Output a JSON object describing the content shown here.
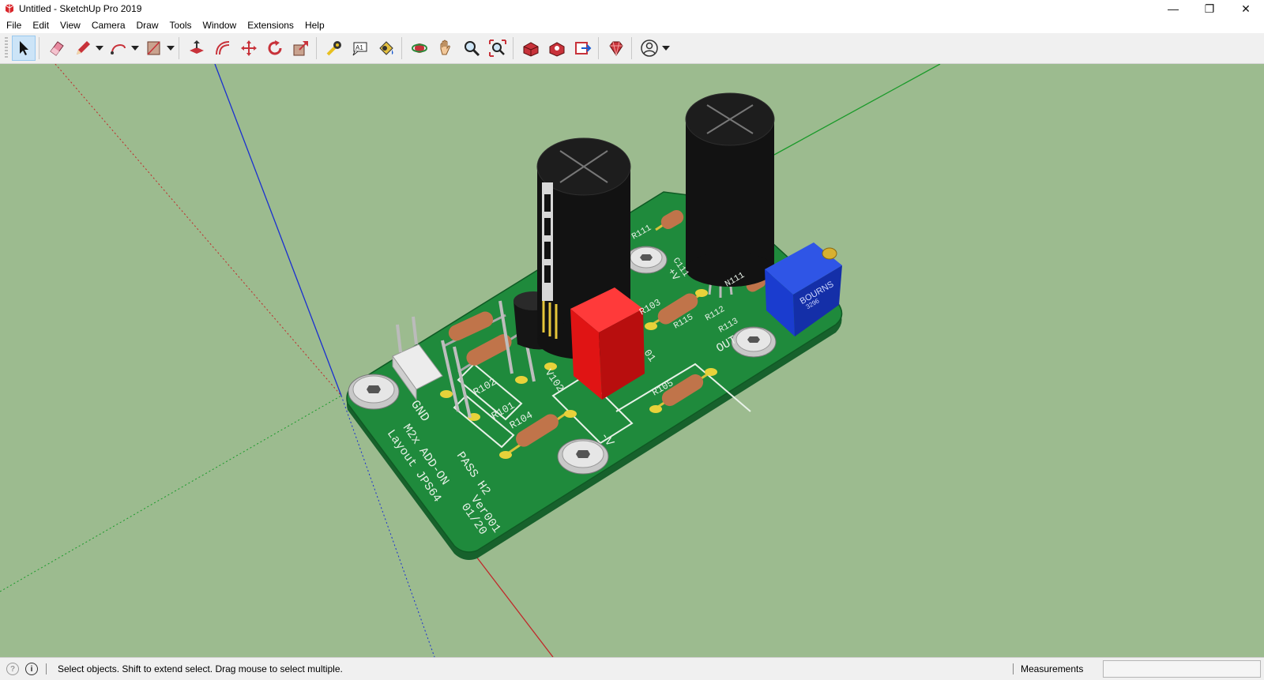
{
  "window": {
    "title": "Untitled - SketchUp Pro 2019",
    "controls": {
      "minimize": "—",
      "restore": "❐",
      "close": "✕"
    }
  },
  "menu": [
    "File",
    "Edit",
    "View",
    "Camera",
    "Draw",
    "Tools",
    "Window",
    "Extensions",
    "Help"
  ],
  "toolbar": [
    {
      "name": "select-tool",
      "icon": "arrow-cursor-icon",
      "active": true
    },
    {
      "name": "eraser-tool",
      "icon": "eraser-icon"
    },
    {
      "name": "line-tool",
      "icon": "pencil-icon",
      "dropdown": true
    },
    {
      "name": "arc-tool",
      "icon": "arc-icon",
      "dropdown": true
    },
    {
      "name": "shape-tool",
      "icon": "rectangle-icon",
      "dropdown": true
    },
    {
      "name": "push-pull-tool",
      "icon": "push-pull-icon"
    },
    {
      "name": "offset-tool",
      "icon": "offset-icon"
    },
    {
      "name": "move-tool",
      "icon": "move-icon"
    },
    {
      "name": "rotate-tool",
      "icon": "rotate-icon"
    },
    {
      "name": "scale-tool",
      "icon": "scale-icon"
    },
    {
      "name": "tape-measure-tool",
      "icon": "tape-measure-icon"
    },
    {
      "name": "text-tool",
      "icon": "text-label-icon"
    },
    {
      "name": "paint-bucket-tool",
      "icon": "paint-bucket-icon"
    },
    {
      "name": "orbit-tool",
      "icon": "orbit-icon"
    },
    {
      "name": "pan-tool",
      "icon": "hand-icon"
    },
    {
      "name": "zoom-tool",
      "icon": "magnifier-icon"
    },
    {
      "name": "zoom-extents-tool",
      "icon": "zoom-extents-icon"
    },
    {
      "name": "3d-warehouse",
      "icon": "warehouse-icon"
    },
    {
      "name": "extension-warehouse",
      "icon": "extension-warehouse-icon"
    },
    {
      "name": "layout-send",
      "icon": "layout-icon"
    },
    {
      "name": "extension-manager",
      "icon": "ruby-gem-icon"
    },
    {
      "name": "account",
      "icon": "user-account-icon",
      "dropdown": true
    }
  ],
  "status": {
    "message": "Select objects. Shift to extend select. Drag mouse to select multiple.",
    "measurements_label": "Measurements",
    "measurements_value": ""
  },
  "model": {
    "silkscreen": [
      "GND",
      "M2x ADD-ON",
      "Layout JPS64",
      "PASS H2",
      "Ver001",
      "01/20",
      "-V",
      "+V",
      "OUT",
      "R101",
      "R102",
      "R103",
      "R104",
      "R105",
      "R111",
      "R112",
      "R113",
      "R115",
      "C111",
      "N111",
      "V102",
      "01"
    ],
    "trimmer_brand": "BOURNS",
    "trimmer_code": "3296",
    "colors": {
      "background": "#9cbb8f",
      "pcb": "#1f8a3c",
      "pads": "#e8d23a",
      "capacitor": "#111111",
      "relay": "#e01414",
      "trimmer": "#1a3ccf",
      "resistor": "#c0744a"
    }
  }
}
